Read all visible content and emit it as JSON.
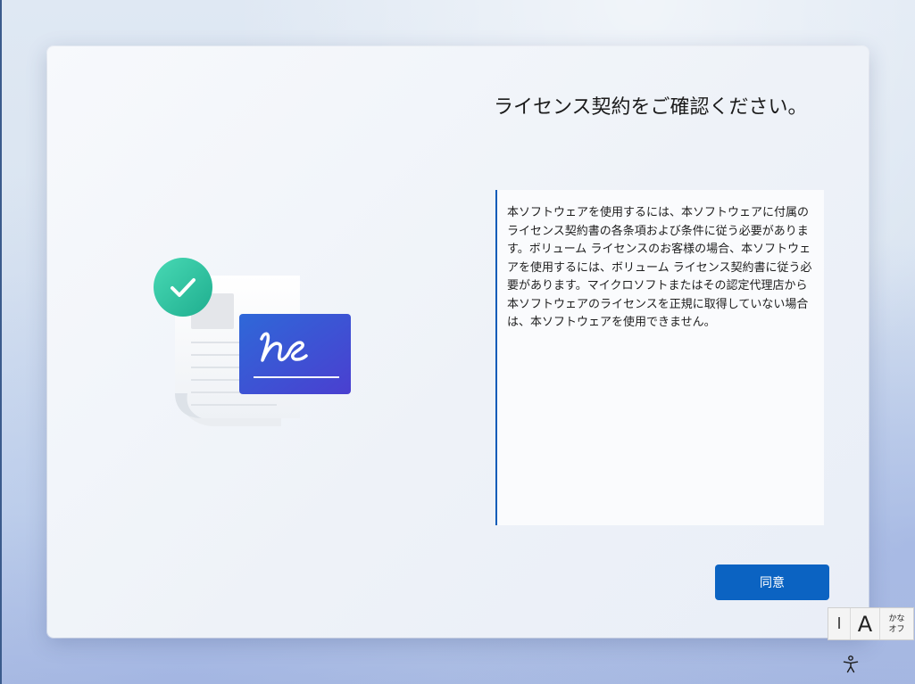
{
  "oobe": {
    "title": "ライセンス契約をご確認ください。",
    "license_text": "本ソフトウェアを使用するには、本ソフトウェアに付属のライセンス契約書の各条項および条件に従う必要があります。ボリューム ライセンスのお客様の場合、本ソフトウェアを使用するには、ボリューム ライセンス契約書に従う必要があります。マイクロソフトまたはその認定代理店から本ソフトウェアのライセンスを正規に取得していない場合は、本ソフトウェアを使用できません。",
    "agree_label": "同意",
    "illustration_icon": "signed-document-checkmark-icon"
  },
  "taskbar": {
    "ime": {
      "caret": "I",
      "mode": "A",
      "kana_top": "かな",
      "kana_bottom": "オフ"
    },
    "accessibility_icon": "accessibility-icon"
  },
  "colors": {
    "accent": "#0b63c2",
    "check_green": "#2fc79f",
    "signature_blue": "#3b4fd8",
    "title_text": "#1b1b1b"
  }
}
